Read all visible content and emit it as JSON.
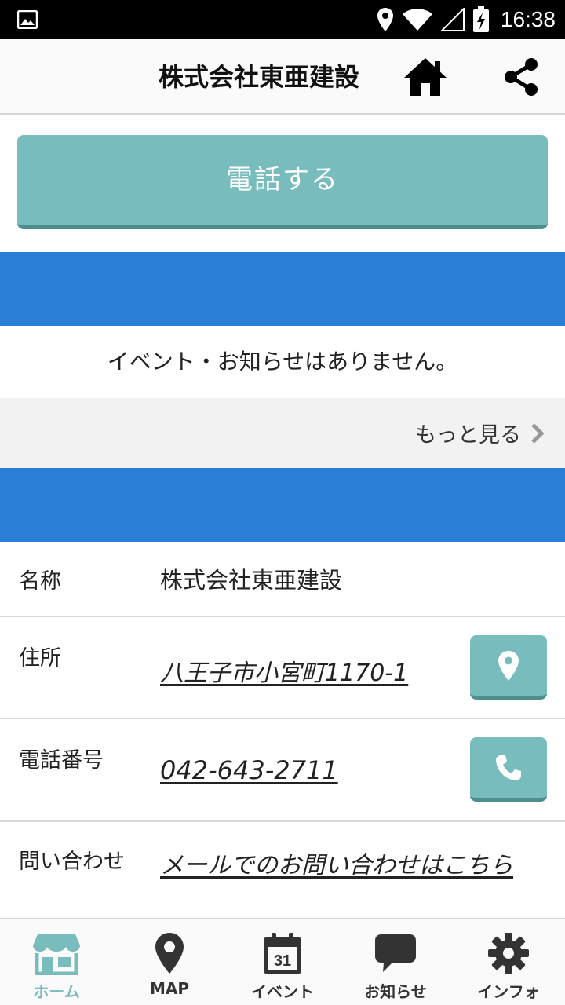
{
  "status_bar": {
    "time": "16:38"
  },
  "app_bar": {
    "title": "株式会社東亜建設"
  },
  "call_button": {
    "label": "電話する"
  },
  "events": {
    "empty_message": "イベント・お知らせはありません。",
    "more_label": "もっと見る"
  },
  "info": {
    "name": {
      "label": "名称",
      "value": "株式会社東亜建設"
    },
    "address": {
      "label": "住所",
      "value": "八王子市小宮町1170-1"
    },
    "phone": {
      "label": "電話番号",
      "value": "042-643-2711"
    },
    "contact": {
      "label": "問い合わせ",
      "value": "メールでのお問い合わせはこちら"
    }
  },
  "bottom_nav": {
    "items": [
      {
        "label": "ホーム",
        "icon": "shop-icon",
        "active": true
      },
      {
        "label": "MAP",
        "icon": "map-pin-icon",
        "active": false
      },
      {
        "label": "イベント",
        "icon": "calendar-icon",
        "calendar_day": "31",
        "active": false
      },
      {
        "label": "お知らせ",
        "icon": "speech-bubble-icon",
        "active": false
      },
      {
        "label": "インフォ",
        "icon": "gear-icon",
        "active": false
      }
    ]
  },
  "colors": {
    "accent_teal": "#79bcbd",
    "band_blue": "#2b7ed6",
    "status_bar": "#000000"
  }
}
